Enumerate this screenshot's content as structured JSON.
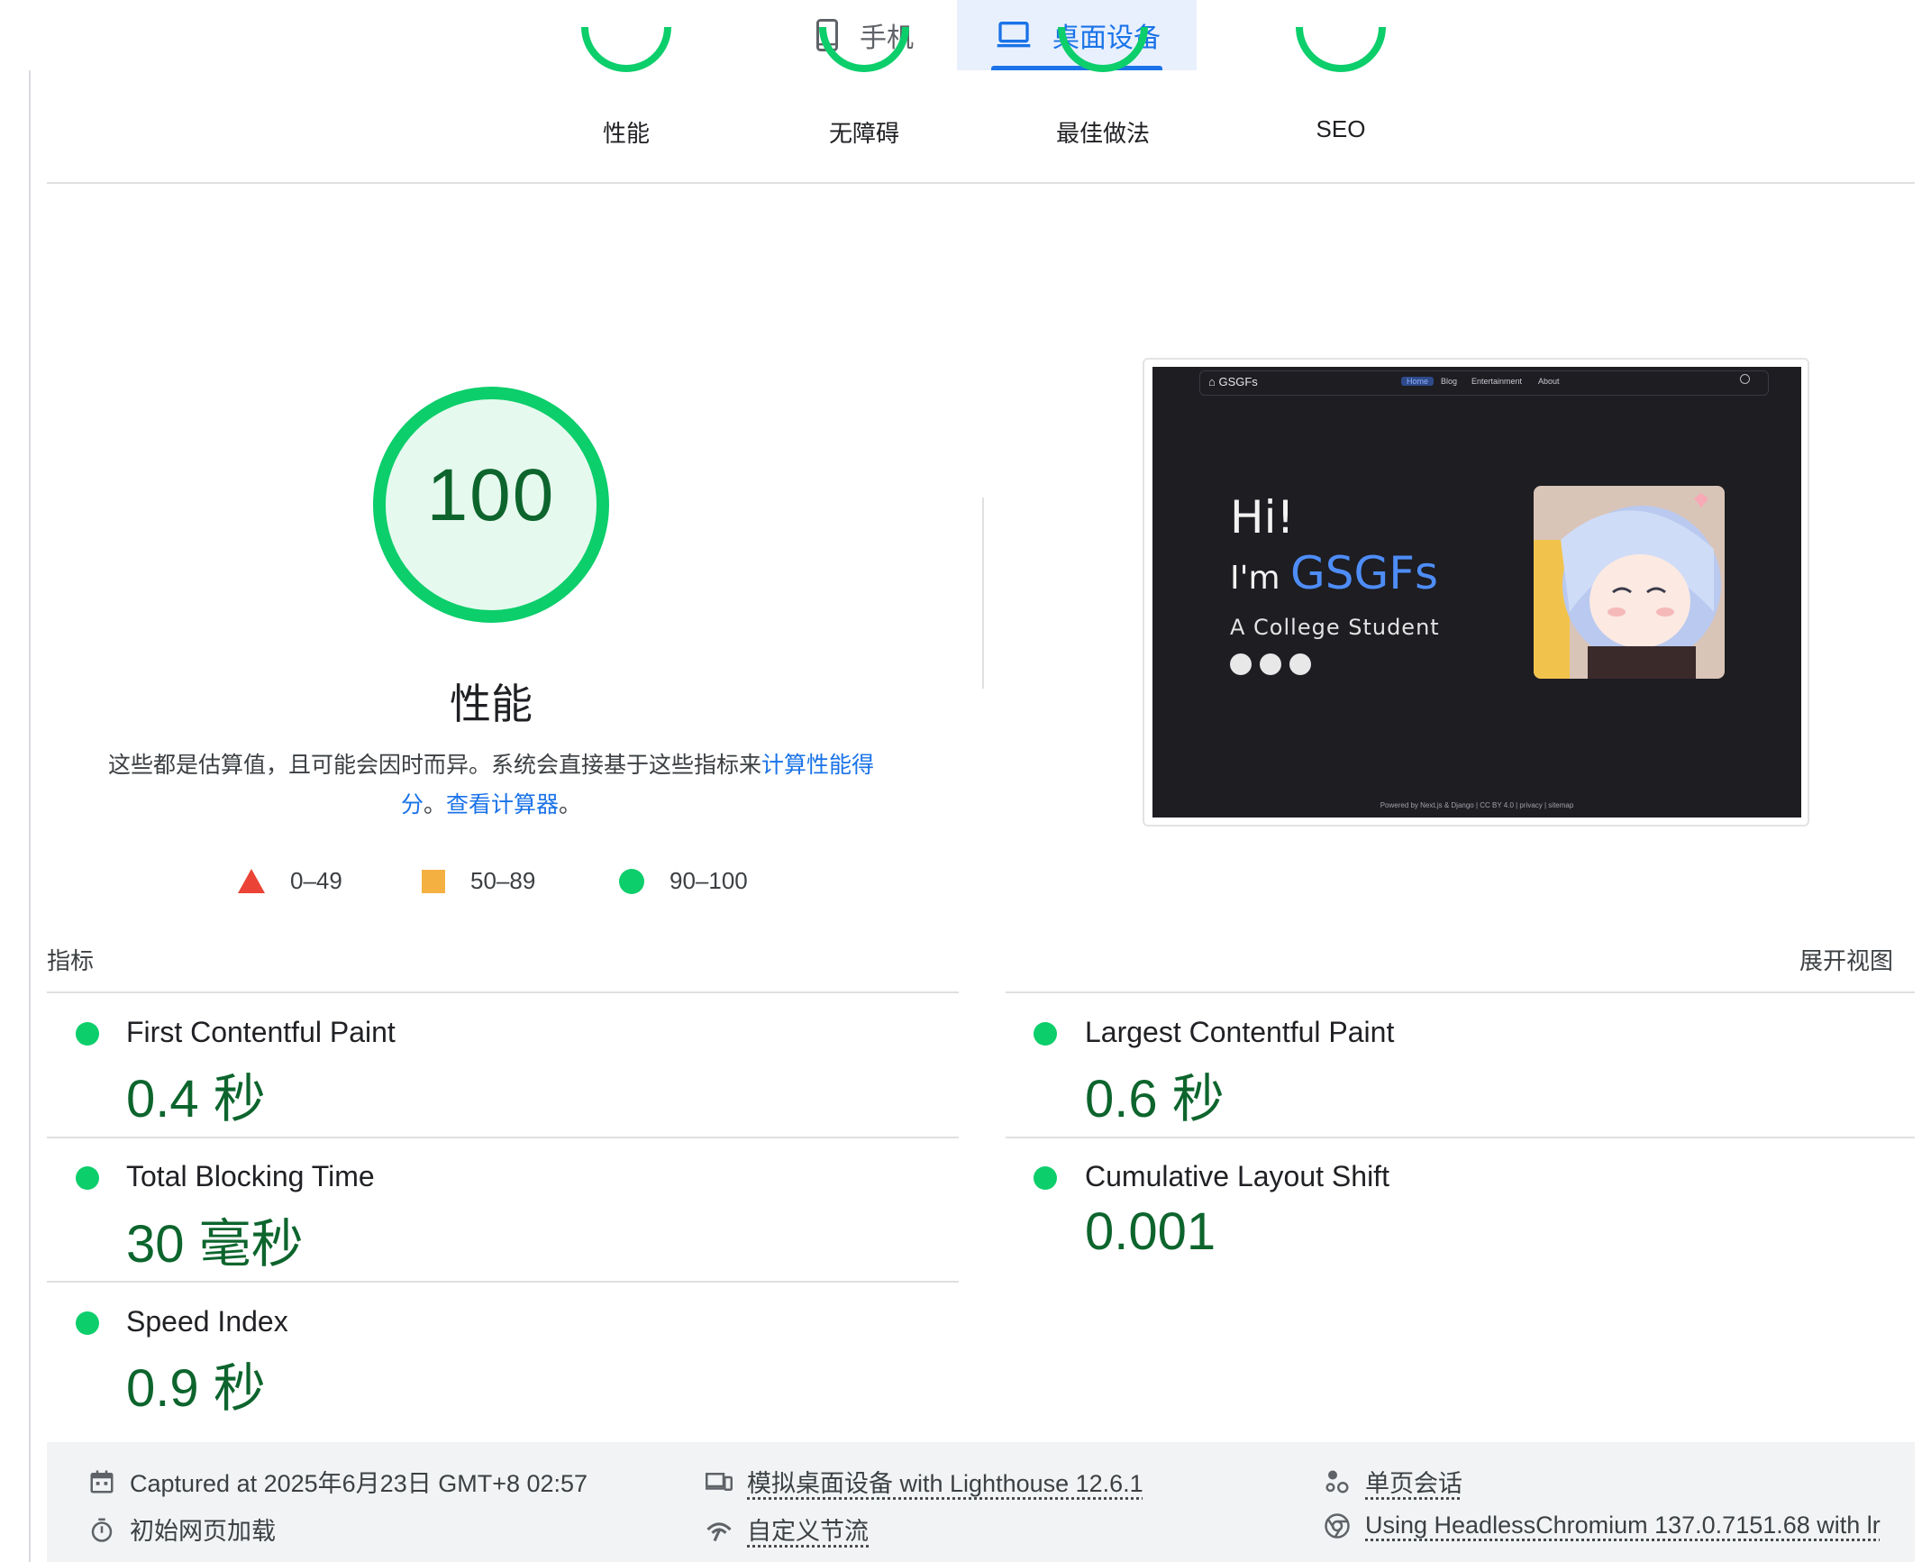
{
  "device_tabs": [
    {
      "label": "手机",
      "icon": "phone-icon",
      "active": false
    },
    {
      "label": "桌面设备",
      "icon": "laptop-icon",
      "active": true
    }
  ],
  "category_gauges": [
    {
      "label": "性能"
    },
    {
      "label": "无障碍"
    },
    {
      "label": "最佳做法"
    },
    {
      "label": "SEO"
    }
  ],
  "performance": {
    "score": "100",
    "title": "性能",
    "description_prefix": "这些都是估算值，且可能会因时而异。系统会直接基于这些指标来",
    "link_calc_score": "计算性能得分",
    "description_sep": "。",
    "link_calculator": "查看计算器",
    "description_end": "。"
  },
  "legend": [
    {
      "shape": "triangle",
      "range": "0–49",
      "color": "#eb4335"
    },
    {
      "shape": "square",
      "range": "50–89",
      "color": "#f4b142"
    },
    {
      "shape": "circle",
      "range": "90–100",
      "color": "#0cce6b"
    }
  ],
  "screenshot": {
    "logo": "GSGFs",
    "nav": [
      "Home",
      "Blog",
      "Entertainment",
      "About"
    ],
    "hi": "Hi!",
    "im_prefix": "I'm ",
    "im_name": "GSGFs",
    "subtitle": "A College Student",
    "footer": "Powered by Next.js & Django | CC BY 4.0 | privacy | sitemap"
  },
  "metrics_section": {
    "label": "指标",
    "expand": "展开视图"
  },
  "metrics": [
    {
      "name": "First Contentful Paint",
      "value": "0.4 秒",
      "status": "pass"
    },
    {
      "name": "Largest Contentful Paint",
      "value": "0.6 秒",
      "status": "pass"
    },
    {
      "name": "Total Blocking Time",
      "value": "30 毫秒",
      "status": "pass"
    },
    {
      "name": "Cumulative Layout Shift",
      "value": "0.001",
      "status": "pass"
    },
    {
      "name": "Speed Index",
      "value": "0.9 秒",
      "status": "pass"
    }
  ],
  "env_info": [
    {
      "icon": "calendar-icon",
      "text": "Captured at 2025年6月23日 GMT+8 02:57"
    },
    {
      "icon": "devices-icon",
      "text": "模拟桌面设备 with Lighthouse 12.6.1"
    },
    {
      "icon": "session-icon",
      "text": "单页会话"
    },
    {
      "icon": "timer-icon",
      "text": "初始网页加载"
    },
    {
      "icon": "throttle-icon",
      "text": "自定义节流"
    },
    {
      "icon": "chrome-icon",
      "text": "Using HeadlessChromium 137.0.7151.68 with lr"
    }
  ],
  "colors": {
    "pass": "#0cce6b",
    "pass_text": "#0d652d",
    "accent": "#1a73e8"
  }
}
